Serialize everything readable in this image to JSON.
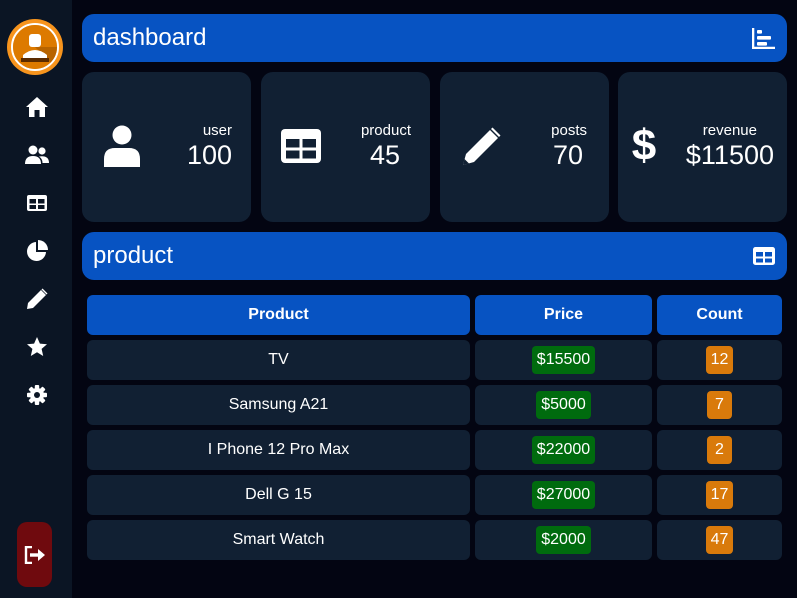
{
  "sidebar": {
    "items": [
      {
        "name": "home",
        "icon": "home-icon"
      },
      {
        "name": "users",
        "icon": "users-icon"
      },
      {
        "name": "table",
        "icon": "table-icon"
      },
      {
        "name": "chart",
        "icon": "pie-chart-icon"
      },
      {
        "name": "posts",
        "icon": "pencil-icon"
      },
      {
        "name": "favorites",
        "icon": "star-icon"
      },
      {
        "name": "settings",
        "icon": "gear-icon"
      }
    ],
    "logout_icon": "sign-out-icon"
  },
  "dashboard": {
    "title": "dashboard",
    "icon": "bar-chart-icon"
  },
  "cards": [
    {
      "label": "user",
      "value": "100",
      "icon": "user-icon"
    },
    {
      "label": "product",
      "value": "45",
      "icon": "table-icon"
    },
    {
      "label": "posts",
      "value": "70",
      "icon": "pencil-icon"
    },
    {
      "label": "revenue",
      "value": "$11500",
      "icon": "dollar-icon"
    }
  ],
  "product_section": {
    "title": "product",
    "icon": "table-icon",
    "columns": [
      "Product",
      "Price",
      "Count"
    ],
    "rows": [
      {
        "product": "TV",
        "price": "$15500",
        "count": "12"
      },
      {
        "product": "Samsung A21",
        "price": "$5000",
        "count": "7"
      },
      {
        "product": "I Phone 12 Pro Max",
        "price": "$22000",
        "count": "2"
      },
      {
        "product": "Dell G 15",
        "price": "$27000",
        "count": "17"
      },
      {
        "product": "Smart Watch",
        "price": "$2000",
        "count": "47"
      }
    ]
  },
  "colors": {
    "background": "#030512",
    "sidebar": "#0b1524",
    "accent_blue": "#0753c2",
    "card": "#112033",
    "price_badge": "#006b0e",
    "count_badge": "#d97a0b",
    "logout": "#6f0a0e",
    "avatar": "#f7941d"
  }
}
